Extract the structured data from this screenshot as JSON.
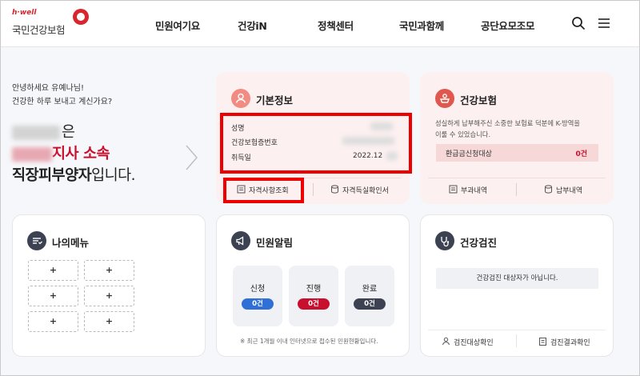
{
  "header": {
    "logo_small": "h·well",
    "logo_main": "국민건강보험",
    "nav": [
      "민원여기요",
      "건강iN",
      "정책센터",
      "국민과함께",
      "공단요모조모"
    ]
  },
  "greeting": {
    "line1": "안녕하세요 유예나님!",
    "line2": "건강한 하루 보내고 계신가요?",
    "name_suffix": "은",
    "branch": "지사 소속",
    "type": "직장피부양자",
    "type_suffix": "입니다."
  },
  "basic_info": {
    "title": "기본정보",
    "rows": [
      {
        "label": "성명",
        "value": ""
      },
      {
        "label": "건강보험증번호",
        "value": ""
      },
      {
        "label": "취득일",
        "value": "2022.12"
      }
    ],
    "btn_qualification": "자격사항조회",
    "btn_certificate": "자격득실확인서"
  },
  "health_insurance": {
    "title": "건강보험",
    "desc_line1": "성실하게 납부해주신 소중한 보험료 덕분에 K-방역을",
    "desc_line2": "이룰 수 있었습니다.",
    "refund_label": "환급금신청대상",
    "refund_value": "0건",
    "btn_charge": "부과내역",
    "btn_payment": "납부내역"
  },
  "my_menu": {
    "title": "나의메뉴",
    "slots": [
      "+",
      "+",
      "+",
      "+",
      "+",
      "+"
    ]
  },
  "civil_alert": {
    "title": "민원알림",
    "stats": [
      {
        "label": "신청",
        "count": "0건",
        "color": "#2f6fd6"
      },
      {
        "label": "진행",
        "count": "0건",
        "color": "#c8102e"
      },
      {
        "label": "완료",
        "count": "0건",
        "color": "#3d4252"
      }
    ],
    "note": "※ 최근 1개월 이내 인터넷으로 접수된 민원현황입니다."
  },
  "health_check": {
    "title": "건강검진",
    "message": "건강검진 대상자가 아닙니다.",
    "btn_target": "검진대상확인",
    "btn_result": "검진결과확인"
  }
}
